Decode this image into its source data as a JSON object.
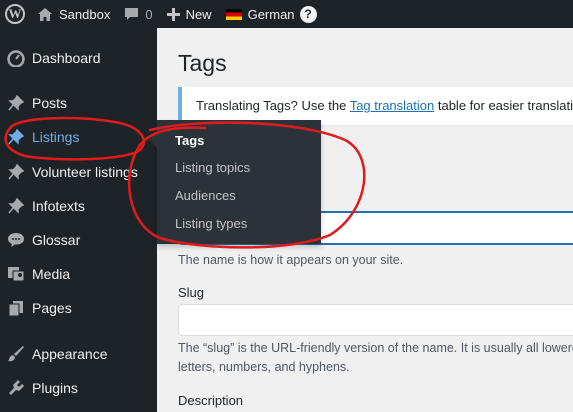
{
  "admin_bar": {
    "site_name": "Sandbox",
    "comments_count": "0",
    "new_label": "New",
    "language_label": "German",
    "help_glyph": "?"
  },
  "sidebar": {
    "items": [
      {
        "label": "Dashboard",
        "icon": "dashboard-icon"
      },
      {
        "label": "Posts",
        "icon": "pin-icon"
      },
      {
        "label": "Listings",
        "icon": "pin-icon",
        "active": true
      },
      {
        "label": "Volunteer listings",
        "icon": "pin-icon"
      },
      {
        "label": "Infotexts",
        "icon": "pin-icon"
      },
      {
        "label": "Glossar",
        "icon": "comment-bubble-icon"
      },
      {
        "label": "Media",
        "icon": "media-icon"
      },
      {
        "label": "Pages",
        "icon": "pages-icon"
      },
      {
        "label": "Appearance",
        "icon": "paintbrush-icon"
      },
      {
        "label": "Plugins",
        "icon": "plugin-icon"
      }
    ]
  },
  "flyout": {
    "items": [
      "Tags",
      "Listing topics",
      "Audiences",
      "Listing types"
    ]
  },
  "main": {
    "title": "Tags",
    "notice_prefix": "Translating Tags? Use the ",
    "notice_link": "Tag translation",
    "notice_suffix": " table for easier translation",
    "name_help": "The name is how it appears on your site.",
    "slug_label": "Slug",
    "slug_help_line1": "The “slug” is the URL-friendly version of the name. It is usually all lowercase",
    "slug_help_line2": "letters, numbers, and hyphens.",
    "description_label": "Description"
  },
  "colors": {
    "admin_bg": "#1d2327",
    "accent_blue": "#72aee6",
    "link_blue": "#2271b1",
    "annotation_red": "#e01b1b"
  }
}
